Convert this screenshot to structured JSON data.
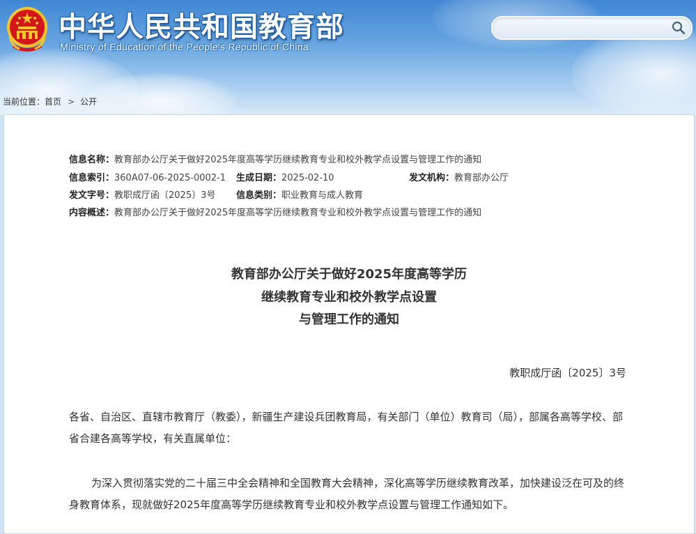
{
  "header": {
    "title_cn": "中华人民共和国教育部",
    "title_en": "Ministry of Education of the People's Republic of China",
    "search": {
      "placeholder": "",
      "value": ""
    },
    "colors": {
      "sky_top": "#3f86d3",
      "sky_bottom": "#d9eaf8",
      "title_outline": "#1f5fa8",
      "emblem_red": "#d4161c",
      "emblem_gold": "#f6c52a"
    }
  },
  "breadcrumb": {
    "prefix": "当前位置：",
    "items": [
      "首页",
      "公开"
    ],
    "separator": ">"
  },
  "meta": {
    "name_label": "信息名称：",
    "name_value": "教育部办公厅关于做好2025年度高等学历继续教育专业和校外教学点设置与管理工作的通知",
    "index_label": "信息索引：",
    "index_value": "360A07-06-2025-0002-1",
    "date_label": "生成日期：",
    "date_value": "2025-02-10",
    "org_label": "发文机构：",
    "org_value": "教育部办公厅",
    "docno_label": "发文字号：",
    "docno_value": "教职成厅函〔2025〕3号",
    "category_label": "信息类别：",
    "category_value": "职业教育与成人教育",
    "summary_label": "内容概述：",
    "summary_value": "教育部办公厅关于做好2025年度高等学历继续教育专业和校外教学点设置与管理工作的通知"
  },
  "document": {
    "title_lines": [
      "教育部办公厅关于做好2025年度高等学历",
      "继续教育专业和校外教学点设置",
      "与管理工作的通知"
    ],
    "doc_number": "教职成厅函〔2025〕3号",
    "addressee": "各省、自治区、直辖市教育厅（教委），新疆生产建设兵团教育局，有关部门（单位）教育司（局），部属各高等学校、部省合建各高等学校，有关直属单位：",
    "intro": "为深入贯彻落实党的二十届三中全会精神和全国教育大会精神，深化高等学历继续教育改革，加快建设泛在可及的终身教育体系，现就做好2025年度高等学历继续教育专业和校外教学点设置与管理工作通知如下。"
  }
}
